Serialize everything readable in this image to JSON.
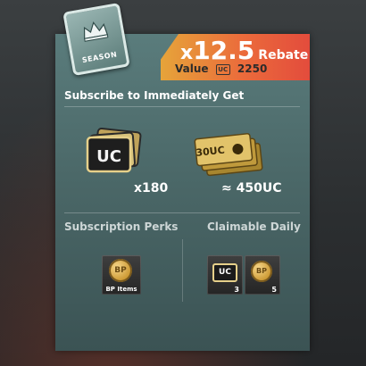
{
  "season_badge": {
    "label": "SEASON",
    "icon": "crown-icon"
  },
  "rebate": {
    "multiplier_prefix": "x",
    "multiplier": "12.5",
    "word": "Rebate",
    "value_label": "Value",
    "value_currency": "UC",
    "value_amount": "2250"
  },
  "immediate": {
    "title": "Subscribe to Immediately Get",
    "items": [
      {
        "name": "uc-cards",
        "qty": "x180"
      },
      {
        "name": "uc-vouchers",
        "qty": "≈ 450UC",
        "voucher_label": "30UC"
      }
    ]
  },
  "perks": {
    "title": "Subscription Perks",
    "item_caption": "BP Items",
    "coin_label": "BP"
  },
  "daily": {
    "title": "Claimable Daily",
    "items": [
      {
        "icon": "UC",
        "count": "3"
      },
      {
        "icon": "BP",
        "count": "5"
      }
    ]
  },
  "colors": {
    "panel": "#4b6868",
    "ribbon_start": "#e6a43a",
    "ribbon_end": "#e34c3c",
    "gold": "#d4a73a"
  }
}
